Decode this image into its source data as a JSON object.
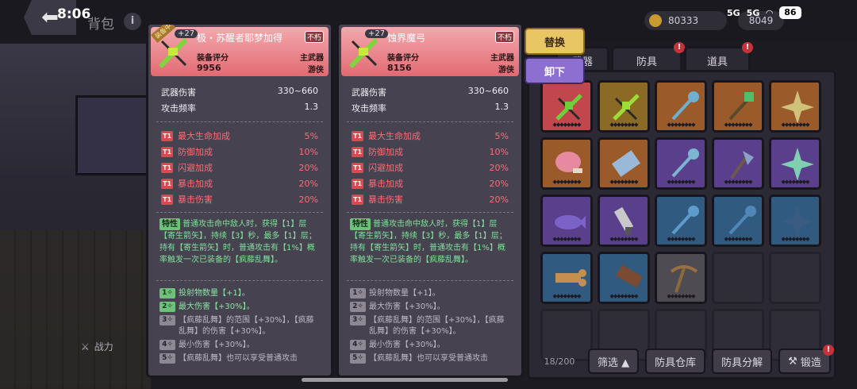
{
  "status_bar": {
    "time": "8:06",
    "net1": "5G",
    "net2": "5G",
    "battery": "86"
  },
  "header": {
    "title": "背包",
    "info": "i",
    "coins": "80333",
    "gems": "8049"
  },
  "actions": {
    "swap": "替换",
    "unequip": "卸下"
  },
  "side": {
    "power": "战力"
  },
  "tabs": [
    {
      "label": "武器",
      "badge": ""
    },
    {
      "label": "防具",
      "badge": "!"
    },
    {
      "label": "道具",
      "badge": "!"
    }
  ],
  "inventory": {
    "count": "18/200",
    "filter": "筛选 ▲",
    "warehouse": "防具仓库",
    "salvage": "防具分解",
    "forge": "锻造",
    "forge_badge": "!",
    "slots": [
      {
        "rarity": "red",
        "icon": "bow-icon",
        "color": "#6fcf3a"
      },
      {
        "rarity": "gold",
        "icon": "bow-icon",
        "color": "#9fdc3a"
      },
      {
        "rarity": "orange",
        "icon": "staff-icon",
        "color": "#6fb0d0"
      },
      {
        "rarity": "orange",
        "icon": "scepter-icon",
        "color": "#4ec06a"
      },
      {
        "rarity": "orange",
        "icon": "shuriken-icon",
        "color": "#cfc07a"
      },
      {
        "rarity": "orange",
        "icon": "meat-icon",
        "color": "#e78aa0"
      },
      {
        "rarity": "orange",
        "icon": "scroll-icon",
        "color": "#9ab8d8"
      },
      {
        "rarity": "purple",
        "icon": "staff-icon",
        "color": "#7ab6cf"
      },
      {
        "rarity": "purple",
        "icon": "axe-icon",
        "color": "#8aa0c8"
      },
      {
        "rarity": "purple",
        "icon": "shuriken-icon",
        "color": "#7fd0b0"
      },
      {
        "rarity": "purple",
        "icon": "fish-icon",
        "color": "#7a62c8"
      },
      {
        "rarity": "purple",
        "icon": "knife-icon",
        "color": "#c8c8cc"
      },
      {
        "rarity": "blue",
        "icon": "staff-icon",
        "color": "#5c9bcc"
      },
      {
        "rarity": "blue",
        "icon": "staff-icon",
        "color": "#4f88b8"
      },
      {
        "rarity": "blue",
        "icon": "shuriken-icon",
        "color": "#3a5c80"
      },
      {
        "rarity": "blue",
        "icon": "bone-icon",
        "color": "#c49050"
      },
      {
        "rarity": "blue",
        "icon": "club-icon",
        "color": "#7a4a32"
      },
      {
        "rarity": "gray",
        "icon": "pickaxe-icon",
        "color": "#9a7040"
      },
      {
        "rarity": "empty"
      },
      {
        "rarity": "empty"
      },
      {
        "rarity": "empty"
      },
      {
        "rarity": "empty"
      },
      {
        "rarity": "empty"
      },
      {
        "rarity": "empty"
      },
      {
        "rarity": "empty"
      }
    ]
  },
  "cards": [
    {
      "equipped": "装备中",
      "level": "+27",
      "name": "极・苏醒者耶梦加得",
      "lock": "不朽",
      "score_label": "装备评分",
      "score": "9956",
      "slot": "主武器",
      "class": "游侠",
      "stats": [
        {
          "label": "武器伤害",
          "value": "330~660"
        },
        {
          "label": "攻击频率",
          "value": "1.3"
        }
      ],
      "affixes": [
        {
          "tier": "T1",
          "label": "最大生命加成",
          "value": "5%"
        },
        {
          "tier": "T1",
          "label": "防御加成",
          "value": "10%"
        },
        {
          "tier": "T1",
          "label": "闪避加成",
          "value": "20%"
        },
        {
          "tier": "T1",
          "label": "暴击加成",
          "value": "20%"
        },
        {
          "tier": "T1",
          "label": "暴击伤害",
          "value": "20%"
        }
      ],
      "trait_tag": "特性",
      "trait": "普通攻击命中敌人时，获得【1】层【寄生箭矢】，持续【3】秒，最多【1】层；持有【寄生箭矢】时，普通攻击有【1%】概率触发一次已装备的【疯藤乱舞】。",
      "enchants": [
        {
          "badge": "1✧",
          "text": "投射物数量【+1】。",
          "active": true
        },
        {
          "badge": "2✧",
          "text": "最大伤害【+30%】。",
          "active": true
        },
        {
          "badge": "3✧",
          "text": "【疯藤乱舞】的范围【+30%】，【疯藤乱舞】的伤害【+30%】。",
          "active": false
        },
        {
          "badge": "4✧",
          "text": "最小伤害【+30%】。",
          "active": false
        },
        {
          "badge": "5✧",
          "text": "【疯藤乱舞】也可以享受普通攻击",
          "active": false
        }
      ]
    },
    {
      "equipped": "",
      "level": "+27",
      "name": "蚀界魔弓",
      "lock": "不朽",
      "score_label": "装备评分",
      "score": "8156",
      "slot": "主武器",
      "class": "游侠",
      "stats": [
        {
          "label": "武器伤害",
          "value": "330~660"
        },
        {
          "label": "攻击频率",
          "value": "1.3"
        }
      ],
      "affixes": [
        {
          "tier": "T1",
          "label": "最大生命加成",
          "value": "5%"
        },
        {
          "tier": "T1",
          "label": "防御加成",
          "value": "10%"
        },
        {
          "tier": "T1",
          "label": "闪避加成",
          "value": "20%"
        },
        {
          "tier": "T1",
          "label": "暴击加成",
          "value": "20%"
        },
        {
          "tier": "T1",
          "label": "暴击伤害",
          "value": "20%"
        }
      ],
      "trait_tag": "特性",
      "trait": "普通攻击命中敌人时，获得【1】层【寄生箭矢】，持续【3】秒，最多【1】层；持有【寄生箭矢】时，普通攻击有【1%】概率触发一次已装备的【疯藤乱舞】。",
      "enchants": [
        {
          "badge": "1✧",
          "text": "投射物数量【+1】。",
          "active": false
        },
        {
          "badge": "2✧",
          "text": "最大伤害【+30%】。",
          "active": false
        },
        {
          "badge": "3✧",
          "text": "【疯藤乱舞】的范围【+30%】，【疯藤乱舞】的伤害【+30%】。",
          "active": false
        },
        {
          "badge": "4✧",
          "text": "最小伤害【+30%】。",
          "active": false
        },
        {
          "badge": "5✧",
          "text": "【疯藤乱舞】也可以享受普通攻击",
          "active": false
        }
      ]
    }
  ]
}
